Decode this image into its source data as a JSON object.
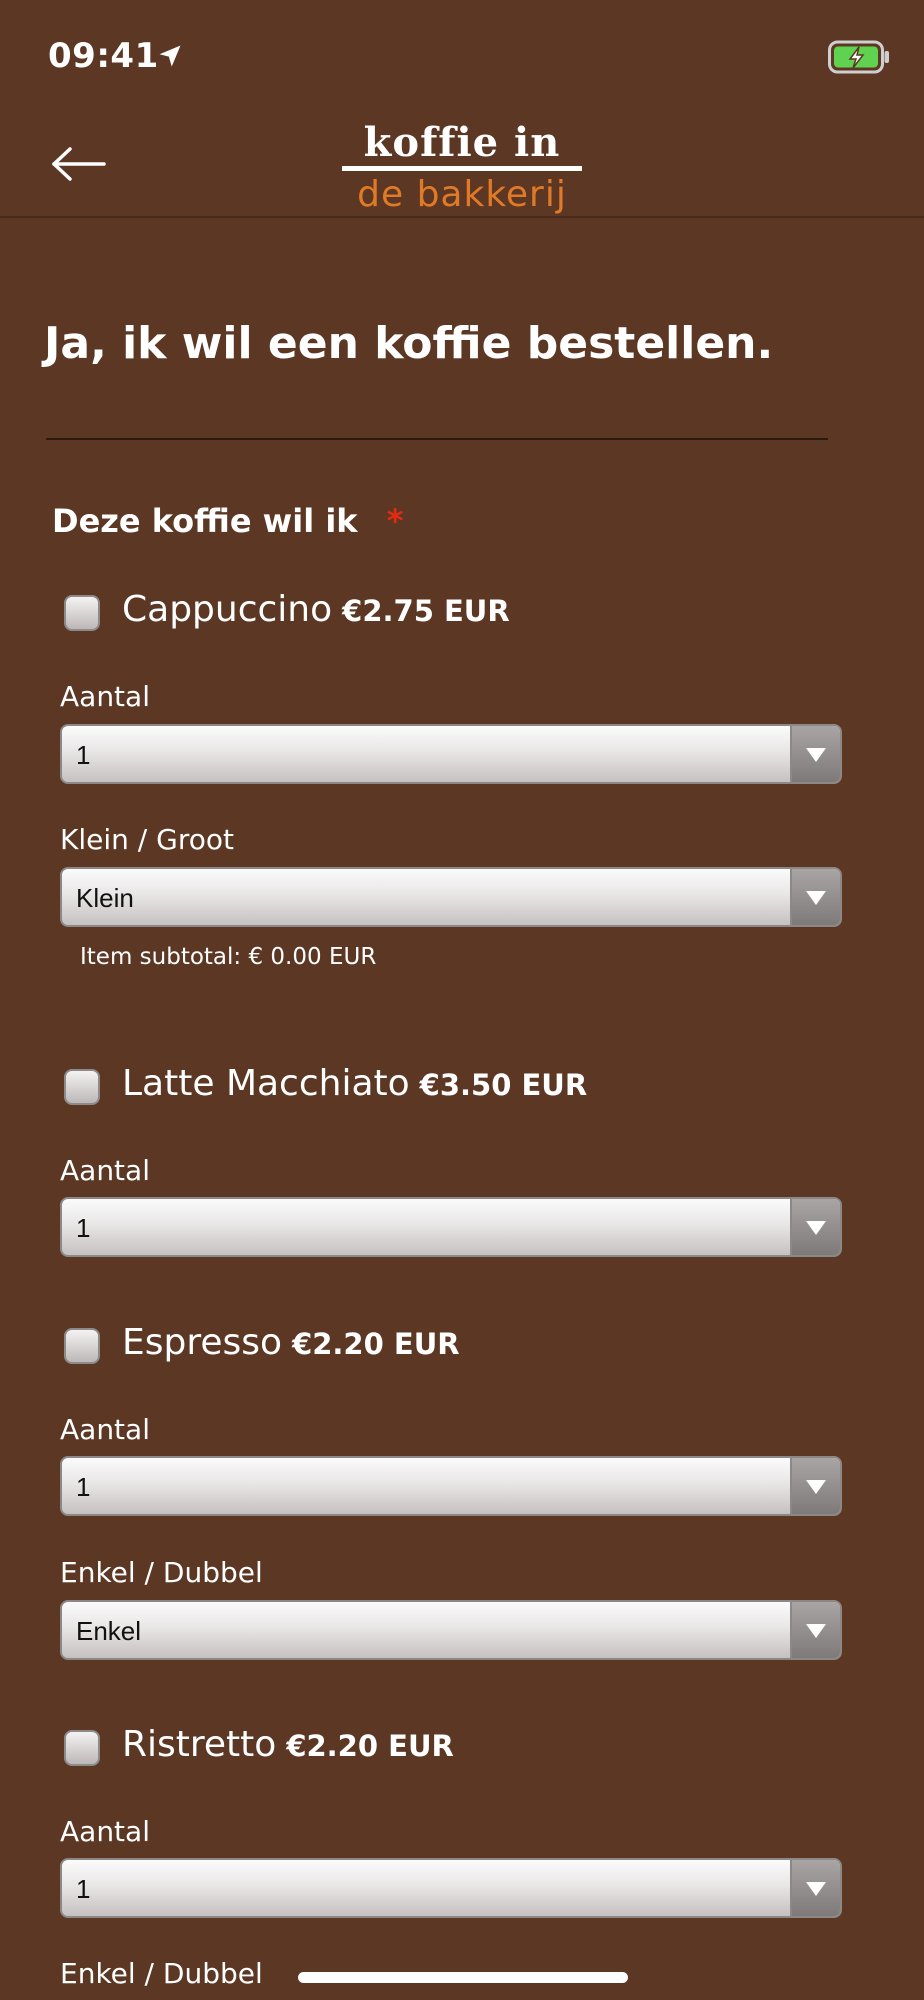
{
  "status_bar": {
    "time": "09:41"
  },
  "header": {
    "logo_line1": "koffie in",
    "logo_line2": "de bakkerij"
  },
  "page": {
    "title": "Ja, ik wil een koffie bestellen.",
    "section_label": "Deze koffie wil ik",
    "required_marker": "*"
  },
  "products": [
    {
      "name": "Cappuccino",
      "price": "€2.75 EUR",
      "quantity_label": "Aantal",
      "quantity_value": "1",
      "option_label": "Klein / Groot",
      "option_value": "Klein",
      "subtotal": "Item subtotal: € 0.00 EUR"
    },
    {
      "name": "Latte Macchiato",
      "price": "€3.50 EUR",
      "quantity_label": "Aantal",
      "quantity_value": "1"
    },
    {
      "name": "Espresso",
      "price": "€2.20 EUR",
      "quantity_label": "Aantal",
      "quantity_value": "1",
      "option_label": "Enkel / Dubbel",
      "option_value": "Enkel"
    },
    {
      "name": "Ristretto",
      "price": "€2.20 EUR",
      "quantity_label": "Aantal",
      "quantity_value": "1",
      "option_label": "Enkel / Dubbel"
    }
  ],
  "colors": {
    "background": "#5c3724",
    "logo_accent": "#e07a26",
    "required": "#e22b12",
    "battery": "#5fd34f"
  },
  "icons": [
    "location-arrow-icon",
    "battery-charging-icon",
    "back-arrow-icon",
    "chevron-down-icon"
  ]
}
